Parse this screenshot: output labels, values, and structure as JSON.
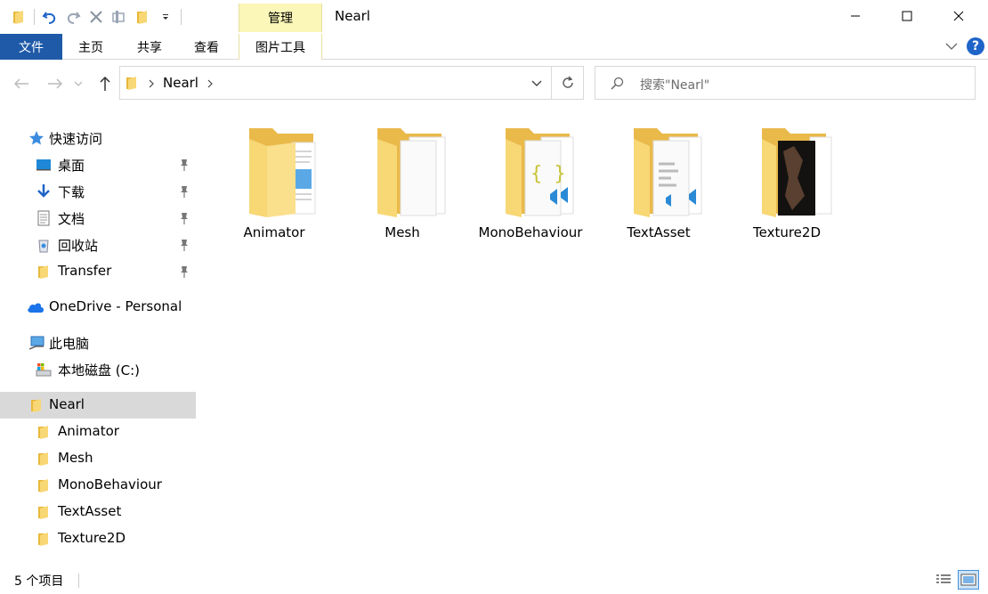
{
  "window": {
    "title": "Nearl",
    "contextual_tab": "管理",
    "minimize_icon": "minimize-icon",
    "maximize_icon": "maximize-icon",
    "close_icon": "close-icon"
  },
  "quick_access_toolbar": [
    "folder-icon",
    "undo-icon",
    "redo-icon",
    "delete-icon",
    "properties-icon",
    "new-folder-icon",
    "dropdown-icon"
  ],
  "ribbon": {
    "tabs": [
      {
        "label": "文件",
        "active": true
      },
      {
        "label": "主页"
      },
      {
        "label": "共享"
      },
      {
        "label": "查看"
      },
      {
        "label": "图片工具"
      }
    ],
    "help_label": "?"
  },
  "address": {
    "path_segment": "Nearl",
    "search_placeholder": "搜索\"Nearl\""
  },
  "nav_pane": {
    "quick_access_label": "快速访问",
    "quick_items": [
      {
        "label": "桌面",
        "icon": "desktop-icon",
        "pinned": true
      },
      {
        "label": "下载",
        "icon": "download-icon",
        "pinned": true
      },
      {
        "label": "文档",
        "icon": "document-icon",
        "pinned": true
      },
      {
        "label": "回收站",
        "icon": "recycle-bin-icon",
        "pinned": true
      },
      {
        "label": "Transfer",
        "icon": "folder-icon",
        "pinned": true
      }
    ],
    "onedrive_label": "OneDrive - Personal",
    "this_pc_label": "此电脑",
    "local_disk_label": "本地磁盘 (C:)",
    "current_folder": "Nearl",
    "subfolders": [
      "Animator",
      "Mesh",
      "MonoBehaviour",
      "TextAsset",
      "Texture2D"
    ]
  },
  "content": {
    "items": [
      {
        "name": "Animator",
        "thumb": "folder-image-preview"
      },
      {
        "name": "Mesh",
        "thumb": "folder-blank-pages"
      },
      {
        "name": "MonoBehaviour",
        "thumb": "folder-json-vscode"
      },
      {
        "name": "TextAsset",
        "thumb": "folder-text-vscode"
      },
      {
        "name": "Texture2D",
        "thumb": "folder-dark-image"
      }
    ]
  },
  "status": {
    "item_count": "5 个项目"
  },
  "colors": {
    "file_tab": "#1e5aa8",
    "manage_tab": "#fbf7b8",
    "folder": "#f8d775",
    "selected_nav": "#d9d9d9",
    "accent": "#1f64c8"
  }
}
